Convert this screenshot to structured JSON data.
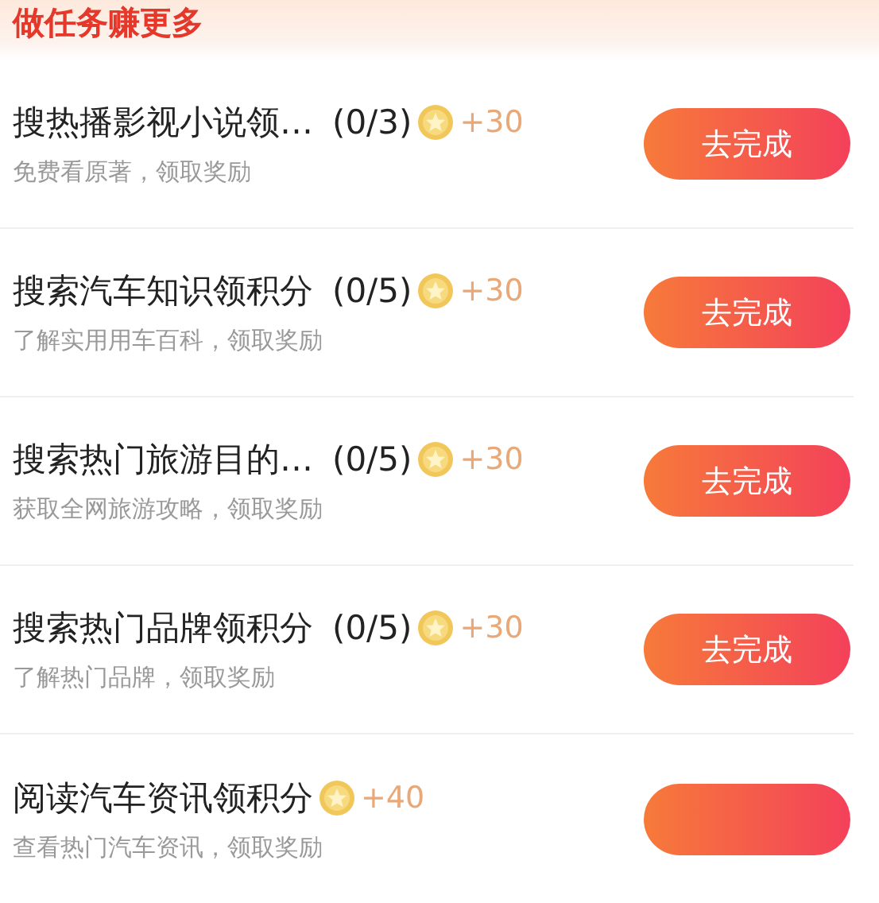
{
  "header": {
    "title": "做任务赚更多"
  },
  "tasks": [
    {
      "title": "搜热播影视小说领…",
      "progress": "(0/3)",
      "reward": "+30",
      "subtitle": "免费看原著，领取奖励",
      "button": "去完成"
    },
    {
      "title": "搜索汽车知识领积分",
      "progress": "(0/5)",
      "reward": "+30",
      "subtitle": "了解实用用车百科，领取奖励",
      "button": "去完成"
    },
    {
      "title": "搜索热门旅游目的…",
      "progress": "(0/5)",
      "reward": "+30",
      "subtitle": "获取全网旅游攻略，领取奖励",
      "button": "去完成"
    },
    {
      "title": "搜索热门品牌领积分",
      "progress": "(0/5)",
      "reward": "+30",
      "subtitle": "了解热门品牌，领取奖励",
      "button": "去完成"
    },
    {
      "title": "阅读汽车资讯领积分",
      "reward": "+40",
      "subtitle": "查看热门汽车资讯，领取奖励"
    }
  ]
}
